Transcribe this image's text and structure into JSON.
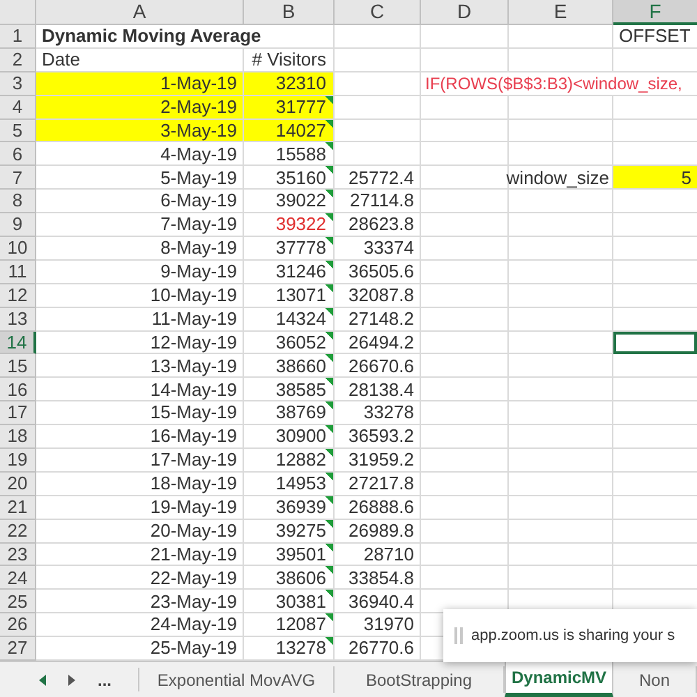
{
  "columns": [
    "A",
    "B",
    "C",
    "D",
    "E",
    "F"
  ],
  "rows": [
    {
      "number": "1",
      "a": "Dynamic Moving Average",
      "f": "OFFSET",
      "highlighted": false,
      "b_marker": false,
      "b_red": false,
      "f_highlighted": false,
      "f_selected": false
    },
    {
      "number": "2",
      "a": "Date",
      "b": "# Visitors",
      "highlighted": false,
      "b_marker": false,
      "b_red": false,
      "f_highlighted": false,
      "f_selected": false
    },
    {
      "number": "3",
      "a": "1-May-19",
      "b": "32310",
      "d": "IF(ROWS($B$3:B3)<window_size,",
      "highlighted": true,
      "b_marker": false,
      "b_red": false,
      "f_highlighted": false,
      "f_selected": false
    },
    {
      "number": "4",
      "a": "2-May-19",
      "b": "31777",
      "highlighted": true,
      "b_marker": true,
      "b_red": false,
      "f_highlighted": false,
      "f_selected": false
    },
    {
      "number": "5",
      "a": "3-May-19",
      "b": "14027",
      "highlighted": true,
      "b_marker": true,
      "b_red": false,
      "f_highlighted": false,
      "f_selected": false
    },
    {
      "number": "6",
      "a": "4-May-19",
      "b": "15588",
      "highlighted": false,
      "b_marker": true,
      "b_red": false,
      "f_highlighted": false,
      "f_selected": false
    },
    {
      "number": "7",
      "a": "5-May-19",
      "b": "35160",
      "c": "25772.4",
      "e": "window_size",
      "f": "5",
      "highlighted": false,
      "b_marker": true,
      "b_red": false,
      "f_highlighted": true,
      "f_selected": false
    },
    {
      "number": "8",
      "a": "6-May-19",
      "b": "39022",
      "c": "27114.8",
      "highlighted": false,
      "b_marker": true,
      "b_red": false,
      "f_highlighted": false,
      "f_selected": false
    },
    {
      "number": "9",
      "a": "7-May-19",
      "b": "39322",
      "c": "28623.8",
      "highlighted": false,
      "b_marker": true,
      "b_red": true,
      "f_highlighted": false,
      "f_selected": false
    },
    {
      "number": "10",
      "a": "8-May-19",
      "b": "37778",
      "c": "33374",
      "highlighted": false,
      "b_marker": true,
      "b_red": false,
      "f_highlighted": false,
      "f_selected": false
    },
    {
      "number": "11",
      "a": "9-May-19",
      "b": "31246",
      "c": "36505.6",
      "highlighted": false,
      "b_marker": true,
      "b_red": false,
      "f_highlighted": false,
      "f_selected": false
    },
    {
      "number": "12",
      "a": "10-May-19",
      "b": "13071",
      "c": "32087.8",
      "highlighted": false,
      "b_marker": true,
      "b_red": false,
      "f_highlighted": false,
      "f_selected": false
    },
    {
      "number": "13",
      "a": "11-May-19",
      "b": "14324",
      "c": "27148.2",
      "highlighted": false,
      "b_marker": true,
      "b_red": false,
      "f_highlighted": false,
      "f_selected": false
    },
    {
      "number": "14",
      "a": "12-May-19",
      "b": "36052",
      "c": "26494.2",
      "highlighted": false,
      "b_marker": true,
      "b_red": false,
      "f_highlighted": false,
      "f_selected": true
    },
    {
      "number": "15",
      "a": "13-May-19",
      "b": "38660",
      "c": "26670.6",
      "highlighted": false,
      "b_marker": true,
      "b_red": false,
      "f_highlighted": false,
      "f_selected": false
    },
    {
      "number": "16",
      "a": "14-May-19",
      "b": "38585",
      "c": "28138.4",
      "highlighted": false,
      "b_marker": true,
      "b_red": false,
      "f_highlighted": false,
      "f_selected": false
    },
    {
      "number": "17",
      "a": "15-May-19",
      "b": "38769",
      "c": "33278",
      "highlighted": false,
      "b_marker": true,
      "b_red": false,
      "f_highlighted": false,
      "f_selected": false
    },
    {
      "number": "18",
      "a": "16-May-19",
      "b": "30900",
      "c": "36593.2",
      "highlighted": false,
      "b_marker": true,
      "b_red": false,
      "f_highlighted": false,
      "f_selected": false
    },
    {
      "number": "19",
      "a": "17-May-19",
      "b": "12882",
      "c": "31959.2",
      "highlighted": false,
      "b_marker": true,
      "b_red": false,
      "f_highlighted": false,
      "f_selected": false
    },
    {
      "number": "20",
      "a": "18-May-19",
      "b": "14953",
      "c": "27217.8",
      "highlighted": false,
      "b_marker": true,
      "b_red": false,
      "f_highlighted": false,
      "f_selected": false
    },
    {
      "number": "21",
      "a": "19-May-19",
      "b": "36939",
      "c": "26888.6",
      "highlighted": false,
      "b_marker": true,
      "b_red": false,
      "f_highlighted": false,
      "f_selected": false
    },
    {
      "number": "22",
      "a": "20-May-19",
      "b": "39275",
      "c": "26989.8",
      "highlighted": false,
      "b_marker": true,
      "b_red": false,
      "f_highlighted": false,
      "f_selected": false
    },
    {
      "number": "23",
      "a": "21-May-19",
      "b": "39501",
      "c": "28710",
      "highlighted": false,
      "b_marker": true,
      "b_red": false,
      "f_highlighted": false,
      "f_selected": false
    },
    {
      "number": "24",
      "a": "22-May-19",
      "b": "38606",
      "c": "33854.8",
      "highlighted": false,
      "b_marker": true,
      "b_red": false,
      "f_highlighted": false,
      "f_selected": false
    },
    {
      "number": "25",
      "a": "23-May-19",
      "b": "30381",
      "c": "36940.4",
      "highlighted": false,
      "b_marker": true,
      "b_red": false,
      "f_highlighted": false,
      "f_selected": false
    },
    {
      "number": "26",
      "a": "24-May-19",
      "b": "12087",
      "c": "31970",
      "highlighted": false,
      "b_marker": true,
      "b_red": false,
      "f_highlighted": false,
      "f_selected": false
    },
    {
      "number": "27",
      "a": "25-May-19",
      "b": "13278",
      "c": "26770.6",
      "highlighted": false,
      "b_marker": true,
      "b_red": false,
      "f_highlighted": false,
      "f_selected": false
    }
  ],
  "sheet_tabs": {
    "more": "...",
    "tabs": [
      {
        "label": "Exponential MovAVG",
        "selected": false
      },
      {
        "label": "BootStrapping",
        "selected": false
      },
      {
        "label": "DynamicMV",
        "selected": true
      },
      {
        "label": "Non",
        "selected": false
      }
    ]
  },
  "notification": {
    "text": "app.zoom.us is sharing your s"
  }
}
